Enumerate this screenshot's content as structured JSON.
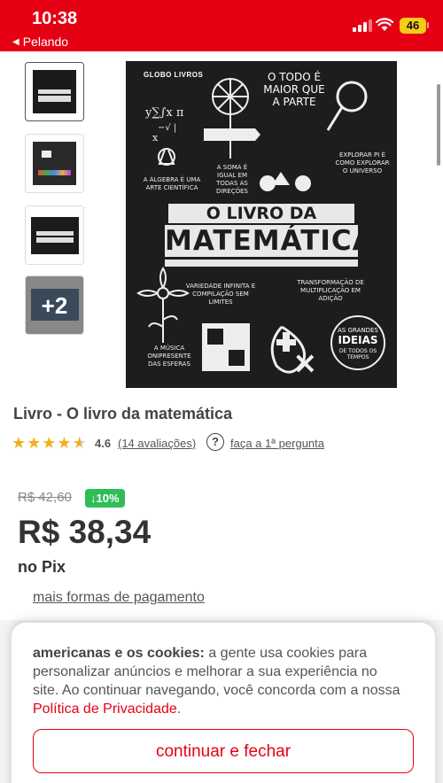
{
  "status_bar": {
    "time": "10:38",
    "back_app": "Pelando",
    "battery": "46",
    "icons": [
      "cellular-signal-icon",
      "wifi-icon",
      "battery-icon"
    ]
  },
  "gallery": {
    "more_label": "+2",
    "cover": {
      "brand": "GLOBO LIVROS",
      "title_line1": "O LIVRO DA",
      "title_line2": "MATEMÁTICA",
      "quote": "O TODO É MAIOR QUE A PARTE",
      "text_algebra": "A ÁLGEBRA É UMA ARTE CIENTÍFICA",
      "text_soma": "A SOMA É IGUAL EM TODAS AS DIREÇÕES",
      "text_explorar": "EXPLORAR PI É COMO EXPLORAR O UNIVERSO",
      "text_variedade": "VARIEDADE INFINITA E COMPILAÇÃO SEM LIMITES",
      "text_transformacao": "TRANSFORMAÇÃO DE MULTIPLICAÇÃO EM ADIÇÃO",
      "text_musica": "A MÚSICA ONIPRESENTE DAS ESFERAS",
      "text_ideias_1": "AS GRANDES",
      "text_ideias_2": "IDEIAS",
      "text_ideias_3": "DE TODOS OS TEMPOS"
    }
  },
  "product": {
    "title": "Livro - O livro da matemática",
    "rating_value": 4.6,
    "rating": "4.6",
    "reviews": "(14 avaliações)",
    "ask": "faça a 1ª pergunta",
    "old_price": "R$ 42,60",
    "discount": "↓10%",
    "price": "R$ 38,34",
    "price_method": "no Pix",
    "more_payments": "mais formas de pagamento"
  },
  "cookie": {
    "bold": "americanas e os cookies:",
    "text": " a gente usa cookies para personalizar anúncios e melhorar a sua experiência no site. Ao continuar navegando, você concorda com a nossa ",
    "link": "Política de Privacidade",
    "end": ".",
    "button": "continuar e fechar"
  },
  "colors": {
    "brand_red": "#e60014",
    "star": "#f2b01e",
    "discount_green": "#2fbd56",
    "battery": "#f5cc17"
  }
}
